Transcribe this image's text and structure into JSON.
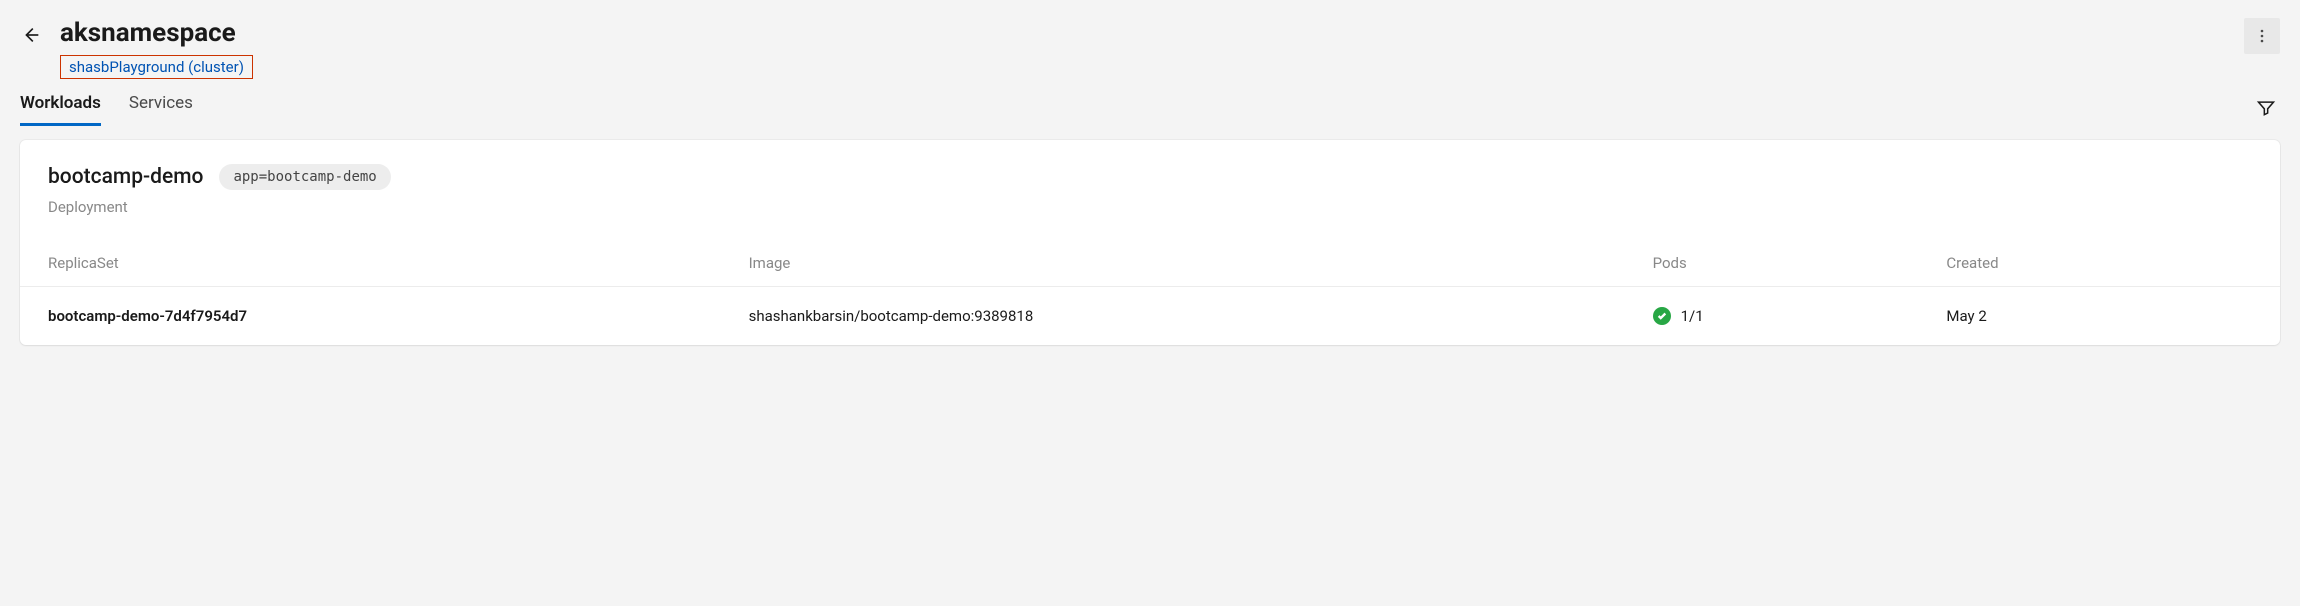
{
  "header": {
    "title": "aksnamespace",
    "cluster_link": "shasbPlayground (cluster)"
  },
  "tabs": [
    {
      "label": "Workloads",
      "active": true
    },
    {
      "label": "Services",
      "active": false
    }
  ],
  "workload": {
    "name": "bootcamp-demo",
    "tag": "app=bootcamp-demo",
    "kind": "Deployment",
    "columns": {
      "replicaset": "ReplicaSet",
      "image": "Image",
      "pods": "Pods",
      "created": "Created"
    },
    "rows": [
      {
        "replicaset": "bootcamp-demo-7d4f7954d7",
        "image": "shashankbarsin/bootcamp-demo:9389818",
        "pods": "1/1",
        "created": "May 2",
        "status": "ok"
      }
    ]
  }
}
